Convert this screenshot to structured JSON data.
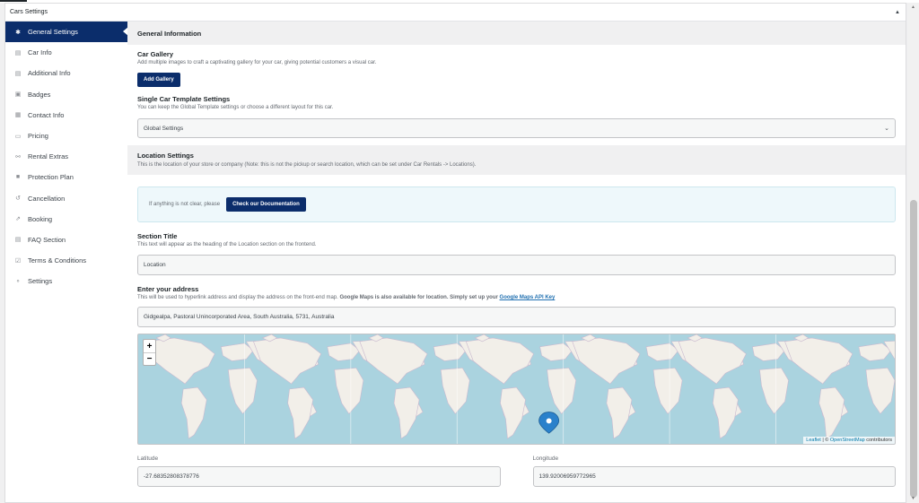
{
  "panel": {
    "title": "Cars Settings"
  },
  "sidebar": {
    "items": [
      {
        "label": "General Settings",
        "icon": "gear-icon",
        "active": true
      },
      {
        "label": "Car Info",
        "icon": "document-icon"
      },
      {
        "label": "Additional Info",
        "icon": "document-icon"
      },
      {
        "label": "Badges",
        "icon": "badge-icon"
      },
      {
        "label": "Contact Info",
        "icon": "contact-card-icon"
      },
      {
        "label": "Pricing",
        "icon": "money-icon"
      },
      {
        "label": "Rental Extras",
        "icon": "extras-icon"
      },
      {
        "label": "Protection Plan",
        "icon": "lock-icon"
      },
      {
        "label": "Cancellation",
        "icon": "undo-icon"
      },
      {
        "label": "Booking",
        "icon": "booking-icon"
      },
      {
        "label": "FAQ Section",
        "icon": "document-icon"
      },
      {
        "label": "Terms & Conditions",
        "icon": "checkbox-icon"
      },
      {
        "label": "Settings",
        "icon": "settings-icon"
      }
    ]
  },
  "general": {
    "title": "General Information"
  },
  "gallery": {
    "title": "Car Gallery",
    "desc": "Add multiple images to craft a captivating gallery for your car, giving potential customers a visual car.",
    "button": "Add Gallery"
  },
  "template": {
    "title": "Single Car Template Settings",
    "desc": "You can keep the Global Template settings or choose a different layout for this car.",
    "selected": "Global Settings"
  },
  "location": {
    "title": "Location Settings",
    "desc": "This is the location of your store or company (Note: this is not the pickup or search location, which can be set under Car Rentals -> Locations)."
  },
  "notice": {
    "text": "If anything is not clear, please",
    "button": "Check our Documentation"
  },
  "section_title": {
    "title": "Section Title",
    "desc": "This text will appear as the heading of the Location section on the frontend.",
    "value": "Location"
  },
  "address": {
    "title": "Enter your address",
    "desc": "This will be used to hyperlink address and display the address on the front-end map.",
    "desc_bold": "Google Maps is also available for location. Simply set up your",
    "link": "Google Maps API Key",
    "value": "Gidgealpa, Pastoral Unincorporated Area, South Australia, 5731, Australia"
  },
  "map": {
    "zoom_in": "+",
    "zoom_out": "−",
    "attr_leaflet": "Leaflet",
    "attr_sep": "| ©",
    "attr_osm": "OpenStreetMap",
    "attr_tail": "contributors",
    "ocean_color": "#aad3df",
    "land_color": "#f2efe9"
  },
  "coords": {
    "lat_label": "Latitude",
    "lat_value": "-27.68352808378776",
    "lng_label": "Longitude",
    "lng_value": "139.92006959772965"
  }
}
